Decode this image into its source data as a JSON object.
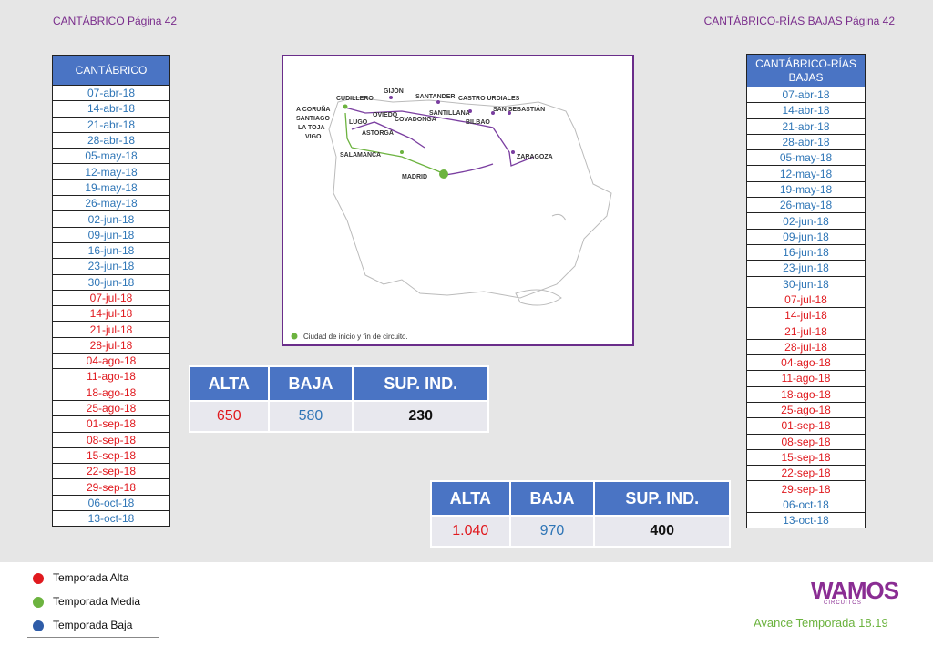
{
  "header": {
    "left": "CANTÁBRICO Página 42",
    "right": "CANTÁBRICO-RÍAS BAJAS Página 42"
  },
  "left_table": {
    "title": "CANTÁBRICO",
    "rows": [
      {
        "date": "07-abr-18",
        "season": "baja"
      },
      {
        "date": "14-abr-18",
        "season": "baja"
      },
      {
        "date": "21-abr-18",
        "season": "baja"
      },
      {
        "date": "28-abr-18",
        "season": "baja"
      },
      {
        "date": "05-may-18",
        "season": "baja"
      },
      {
        "date": "12-may-18",
        "season": "baja"
      },
      {
        "date": "19-may-18",
        "season": "baja"
      },
      {
        "date": "26-may-18",
        "season": "baja"
      },
      {
        "date": "02-jun-18",
        "season": "baja"
      },
      {
        "date": "09-jun-18",
        "season": "baja"
      },
      {
        "date": "16-jun-18",
        "season": "baja"
      },
      {
        "date": "23-jun-18",
        "season": "baja"
      },
      {
        "date": "30-jun-18",
        "season": "baja"
      },
      {
        "date": "07-jul-18",
        "season": "alta"
      },
      {
        "date": "14-jul-18",
        "season": "alta"
      },
      {
        "date": "21-jul-18",
        "season": "alta"
      },
      {
        "date": "28-jul-18",
        "season": "alta"
      },
      {
        "date": "04-ago-18",
        "season": "alta"
      },
      {
        "date": "11-ago-18",
        "season": "alta"
      },
      {
        "date": "18-ago-18",
        "season": "alta"
      },
      {
        "date": "25-ago-18",
        "season": "alta"
      },
      {
        "date": "01-sep-18",
        "season": "alta"
      },
      {
        "date": "08-sep-18",
        "season": "alta"
      },
      {
        "date": "15-sep-18",
        "season": "alta"
      },
      {
        "date": "22-sep-18",
        "season": "alta"
      },
      {
        "date": "29-sep-18",
        "season": "alta"
      },
      {
        "date": "06-oct-18",
        "season": "baja"
      },
      {
        "date": "13-oct-18",
        "season": "baja"
      }
    ]
  },
  "right_table": {
    "title_line1": "CANTÁBRICO-RÍAS",
    "title_line2": "BAJAS",
    "rows": [
      {
        "date": "07-abr-18",
        "season": "baja"
      },
      {
        "date": "14-abr-18",
        "season": "baja"
      },
      {
        "date": "21-abr-18",
        "season": "baja"
      },
      {
        "date": "28-abr-18",
        "season": "baja"
      },
      {
        "date": "05-may-18",
        "season": "baja"
      },
      {
        "date": "12-may-18",
        "season": "baja"
      },
      {
        "date": "19-may-18",
        "season": "baja"
      },
      {
        "date": "26-may-18",
        "season": "baja"
      },
      {
        "date": "02-jun-18",
        "season": "baja"
      },
      {
        "date": "09-jun-18",
        "season": "baja"
      },
      {
        "date": "16-jun-18",
        "season": "baja"
      },
      {
        "date": "23-jun-18",
        "season": "baja"
      },
      {
        "date": "30-jun-18",
        "season": "baja"
      },
      {
        "date": "07-jul-18",
        "season": "alta"
      },
      {
        "date": "14-jul-18",
        "season": "alta"
      },
      {
        "date": "21-jul-18",
        "season": "alta"
      },
      {
        "date": "28-jul-18",
        "season": "alta"
      },
      {
        "date": "04-ago-18",
        "season": "alta"
      },
      {
        "date": "11-ago-18",
        "season": "alta"
      },
      {
        "date": "18-ago-18",
        "season": "alta"
      },
      {
        "date": "25-ago-18",
        "season": "alta"
      },
      {
        "date": "01-sep-18",
        "season": "alta"
      },
      {
        "date": "08-sep-18",
        "season": "alta"
      },
      {
        "date": "15-sep-18",
        "season": "alta"
      },
      {
        "date": "22-sep-18",
        "season": "alta"
      },
      {
        "date": "29-sep-18",
        "season": "alta"
      },
      {
        "date": "06-oct-18",
        "season": "baja"
      },
      {
        "date": "13-oct-18",
        "season": "baja"
      }
    ]
  },
  "map": {
    "cities": [
      "GIJÓN",
      "CUDILLERO",
      "SANTANDER",
      "CASTRO URDIALES",
      "A CORUÑA",
      "SANTIAGO",
      "LA TOJA",
      "VIGO",
      "OVIEDO",
      "SANTILLANA",
      "COVADONGA",
      "SAN SEBASTIÁN",
      "BILBAO",
      "LUGO",
      "ASTORGA",
      "ZARAGOZA",
      "SALAMANCA",
      "MADRID"
    ],
    "legend": "Ciudad de inicio y fin de circuito."
  },
  "price_tables": [
    {
      "headers": [
        "ALTA",
        "BAJA",
        "SUP. IND."
      ],
      "alta": "650",
      "baja": "580",
      "sup": "230"
    },
    {
      "headers": [
        "ALTA",
        "BAJA",
        "SUP. IND."
      ],
      "alta": "1.040",
      "baja": "970",
      "sup": "400"
    }
  ],
  "legend": {
    "alta": {
      "label": "Temporada Alta",
      "color": "#e0191e"
    },
    "media": {
      "label": "Temporada Media",
      "color": "#6cb33f"
    },
    "baja": {
      "label": "Temporada Baja",
      "color": "#2e5ca8"
    }
  },
  "brand": {
    "logo": "WAMOS",
    "logo_sub": "CIRCUITOS",
    "season": "Avance Temporada 18.19"
  },
  "colors": {
    "alta": "#e0191e",
    "baja": "#2e75b6",
    "header_blue": "#4a74c4",
    "purple": "#7a2d8c",
    "green": "#6cb33f"
  }
}
